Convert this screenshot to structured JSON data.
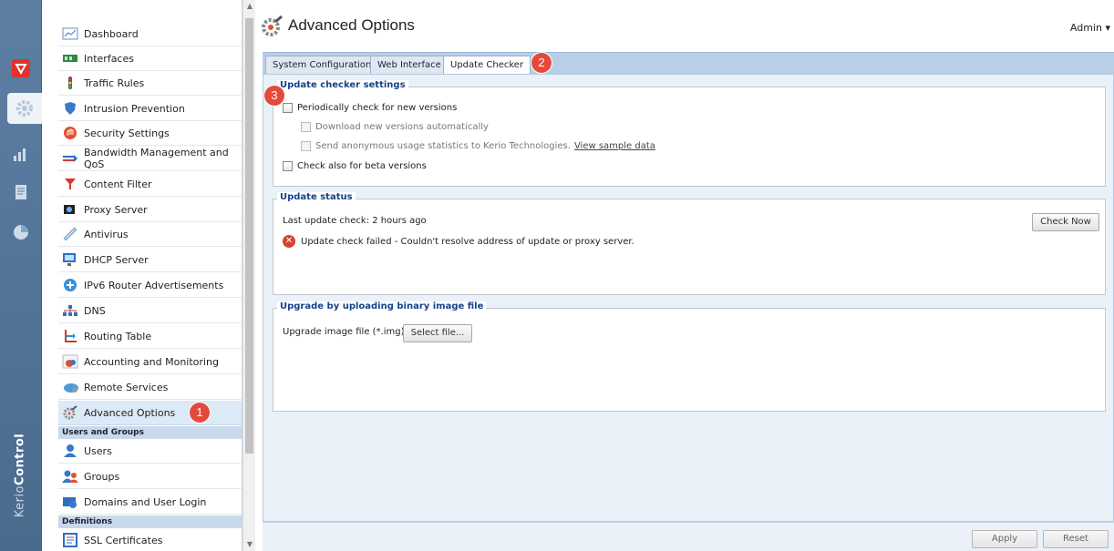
{
  "app": {
    "brand_light": "Kerio",
    "brand_bold": "Control"
  },
  "header": {
    "title": "Advanced Options",
    "user": "Admin"
  },
  "nav": {
    "items": [
      {
        "label": "Dashboard",
        "icon": "dashboard-icon"
      },
      {
        "label": "Interfaces",
        "icon": "interfaces-icon"
      },
      {
        "label": "Traffic Rules",
        "icon": "traffic-rules-icon"
      },
      {
        "label": "Intrusion Prevention",
        "icon": "shield-icon"
      },
      {
        "label": "Security Settings",
        "icon": "security-icon"
      },
      {
        "label": "Bandwidth Management and QoS",
        "icon": "bandwidth-icon"
      },
      {
        "label": "Content Filter",
        "icon": "filter-icon"
      },
      {
        "label": "Proxy Server",
        "icon": "proxy-icon"
      },
      {
        "label": "Antivirus",
        "icon": "antivirus-icon"
      },
      {
        "label": "DHCP Server",
        "icon": "dhcp-icon"
      },
      {
        "label": "IPv6 Router Advertisements",
        "icon": "ipv6-icon"
      },
      {
        "label": "DNS",
        "icon": "dns-icon"
      },
      {
        "label": "Routing Table",
        "icon": "routing-icon"
      },
      {
        "label": "Accounting and Monitoring",
        "icon": "accounting-icon"
      },
      {
        "label": "Remote Services",
        "icon": "cloud-icon"
      },
      {
        "label": "Advanced Options",
        "icon": "gear-icon"
      }
    ],
    "group_users": "Users and Groups",
    "users_items": [
      {
        "label": "Users",
        "icon": "user-icon"
      },
      {
        "label": "Groups",
        "icon": "group-icon"
      },
      {
        "label": "Domains and User Login",
        "icon": "domain-icon"
      }
    ],
    "group_definitions": "Definitions",
    "definition_items": [
      {
        "label": "SSL Certificates",
        "icon": "certificate-icon"
      }
    ]
  },
  "tabs": [
    {
      "label": "System Configuration"
    },
    {
      "label": "Web Interface"
    },
    {
      "label": "Update Checker"
    }
  ],
  "update_settings": {
    "legend": "Update checker settings",
    "periodic": "Periodically check for new versions",
    "download": "Download new versions automatically",
    "send_stats": "Send anonymous usage statistics to Kerio Technologies.",
    "sample_link": "View sample data",
    "beta": "Check also for beta versions"
  },
  "update_status": {
    "legend": "Update status",
    "last_check": "Last update check:  2 hours ago",
    "error": "Update check failed - Couldn't resolve address of update or proxy server.",
    "check_now": "Check Now"
  },
  "upgrade": {
    "legend": "Upgrade by uploading binary image file",
    "file_label": "Upgrade image file (*.img):",
    "select_file": "Select file..."
  },
  "footer": {
    "apply": "Apply",
    "reset": "Reset"
  },
  "badges": [
    "1",
    "2",
    "3"
  ],
  "colors": {
    "accent": "#15428b",
    "badge": "#e34a3b",
    "selected": "#dce9f6",
    "rail": "#5d7fa3"
  }
}
